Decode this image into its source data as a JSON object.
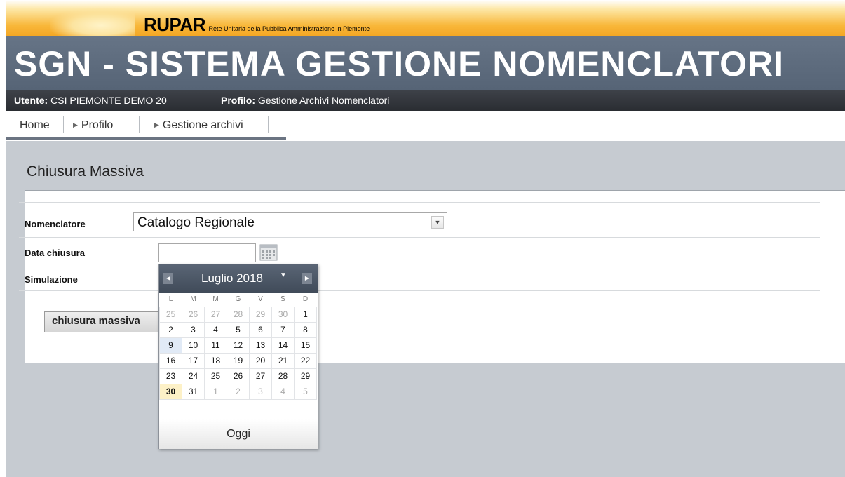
{
  "header": {
    "brand": "RUPAR",
    "brand_sub": "Rete Unitaria della Pubblica Amministrazione in Piemonte",
    "app_title": "SGN - SISTEMA GESTIONE NOMENCLATORI"
  },
  "user_bar": {
    "user_label": "Utente:",
    "user_value": "CSI PIEMONTE DEMO 20",
    "profile_label": "Profilo:",
    "profile_value": "Gestione Archivi Nomenclatori"
  },
  "nav": {
    "home": "Home",
    "profilo": "Profilo",
    "gestione": "Gestione archivi"
  },
  "page": {
    "heading": "Chiusura Massiva",
    "nomenclatore_label": "Nomenclatore",
    "nomenclatore_value": "Catalogo Regionale",
    "data_label": "Data chiusura",
    "data_value": "",
    "simulazione_label": "Simulazione",
    "button_label": "chiusura massiva"
  },
  "datepicker": {
    "month_label": "Luglio 2018",
    "today_label": "Oggi",
    "weekdays": [
      "L",
      "M",
      "M",
      "G",
      "V",
      "S",
      "D"
    ],
    "weeks": [
      [
        {
          "d": "25",
          "o": true
        },
        {
          "d": "26",
          "o": true
        },
        {
          "d": "27",
          "o": true
        },
        {
          "d": "28",
          "o": true
        },
        {
          "d": "29",
          "o": true
        },
        {
          "d": "30",
          "o": true
        },
        {
          "d": "1"
        }
      ],
      [
        {
          "d": "2"
        },
        {
          "d": "3"
        },
        {
          "d": "4"
        },
        {
          "d": "5"
        },
        {
          "d": "6"
        },
        {
          "d": "7"
        },
        {
          "d": "8"
        }
      ],
      [
        {
          "d": "9",
          "sel": true
        },
        {
          "d": "10"
        },
        {
          "d": "11"
        },
        {
          "d": "12"
        },
        {
          "d": "13"
        },
        {
          "d": "14"
        },
        {
          "d": "15"
        }
      ],
      [
        {
          "d": "16"
        },
        {
          "d": "17"
        },
        {
          "d": "18"
        },
        {
          "d": "19"
        },
        {
          "d": "20"
        },
        {
          "d": "21"
        },
        {
          "d": "22"
        }
      ],
      [
        {
          "d": "23"
        },
        {
          "d": "24"
        },
        {
          "d": "25"
        },
        {
          "d": "26"
        },
        {
          "d": "27"
        },
        {
          "d": "28"
        },
        {
          "d": "29"
        }
      ],
      [
        {
          "d": "30",
          "today": true
        },
        {
          "d": "31"
        },
        {
          "d": "1",
          "o": true
        },
        {
          "d": "2",
          "o": true
        },
        {
          "d": "3",
          "o": true
        },
        {
          "d": "4",
          "o": true
        },
        {
          "d": "5",
          "o": true
        }
      ]
    ]
  },
  "icons": {
    "calendar": "calendar-icon",
    "prev": "chevron-left-icon",
    "next": "chevron-right-icon",
    "dropdown": "chevron-down-icon"
  },
  "colors": {
    "header_gradient_top": "#fde7a6",
    "header_gradient_bottom": "#f4a623",
    "title_bar": "#5f6d80",
    "user_bar": "#33373d",
    "content_bg": "#c6cbd1",
    "datepicker_header": "#4d5868"
  }
}
